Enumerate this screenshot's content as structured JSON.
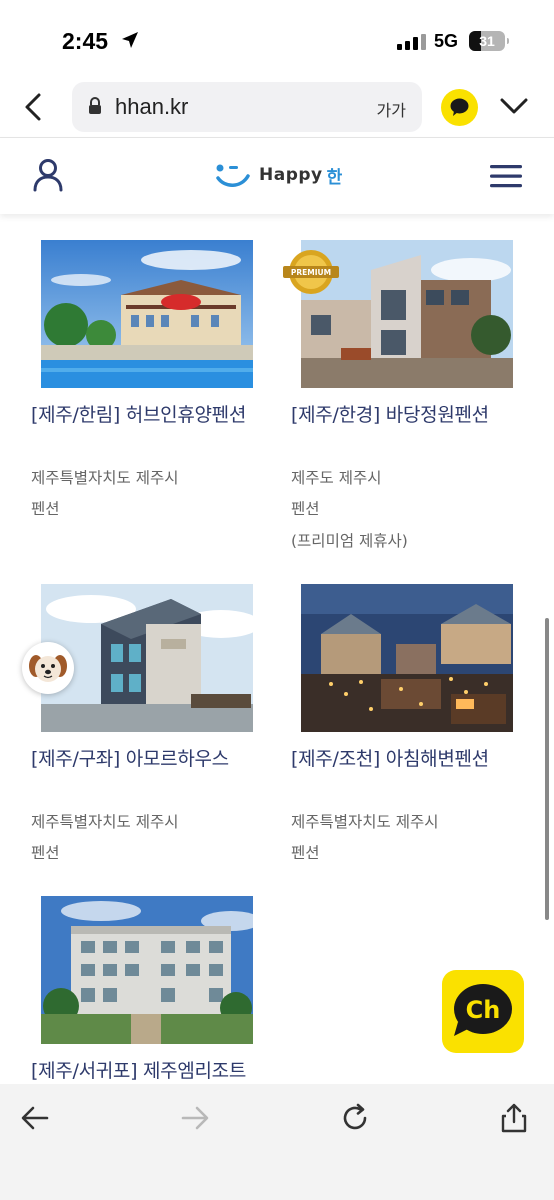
{
  "status_bar": {
    "time": "2:45",
    "network": "5G",
    "battery": "31"
  },
  "browser": {
    "url": "hhan.kr",
    "text_size_label": "가가"
  },
  "site": {
    "logo_text": "Happy",
    "logo_suffix": "한"
  },
  "listings": [
    {
      "title": "[제주/한림] 허브인휴양펜션",
      "region": "제주특별자치도 제주시",
      "type": "펜션",
      "note": ""
    },
    {
      "title": "[제주/한경] 바당정원펜션",
      "region": "제주도 제주시",
      "type": "펜션",
      "note": "(프리미엄 제휴사)",
      "badge": "PREMIUM"
    },
    {
      "title": "[제주/구좌] 아모르하우스",
      "region": "제주특별자치도 제주시",
      "type": "펜션",
      "note": ""
    },
    {
      "title": "[제주/조천] 아침해변펜션",
      "region": "제주특별자치도 제주시",
      "type": "펜션",
      "note": ""
    },
    {
      "title": "[제주/서귀포] 제주엠리조트",
      "region": "",
      "type": "",
      "note": ""
    }
  ],
  "chat_button": {
    "label": "Ch"
  },
  "icons": {
    "status": [
      "location-arrow-icon",
      "signal-icon",
      "battery-icon"
    ],
    "browser": [
      "back-chevron-icon",
      "lock-icon",
      "kakao-talk-icon",
      "chevron-down-icon"
    ],
    "header": [
      "user-icon",
      "hamburger-menu-icon"
    ],
    "toolbar": [
      "arrow-left-icon",
      "arrow-right-icon",
      "reload-icon",
      "share-icon"
    ]
  },
  "colors": {
    "accent_title": "#2e3a6b",
    "kakao_yellow": "#fae100",
    "logo_blue": "#2b8fd6"
  }
}
